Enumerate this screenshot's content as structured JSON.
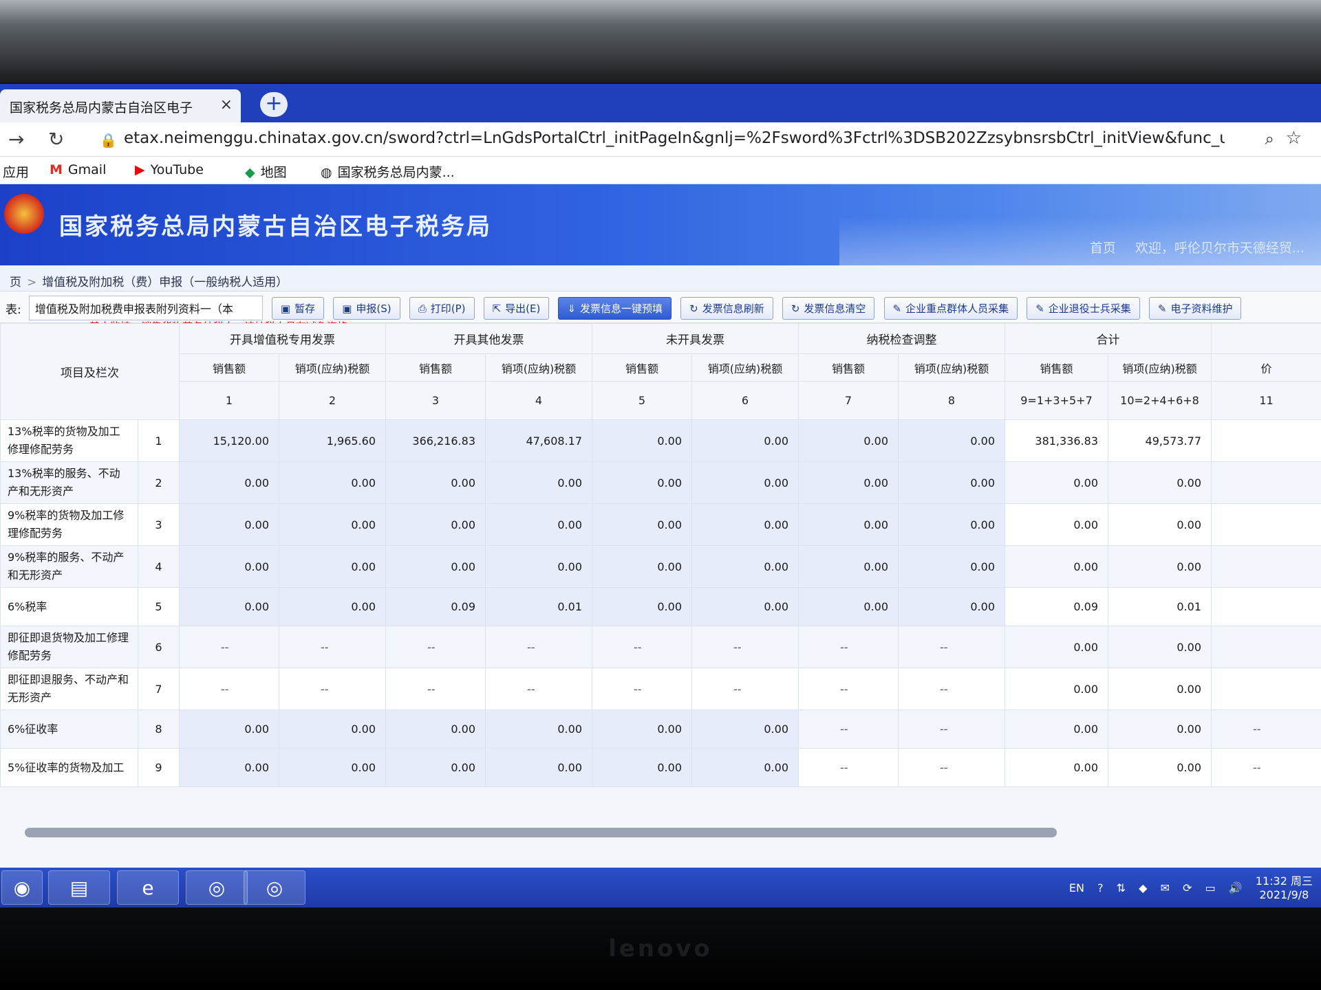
{
  "browser": {
    "tab_title": "国家税务总局内蒙古自治区电子",
    "tab_close": "×",
    "new_tab": "+",
    "url_host": "etax.neimenggu.chinatax.gov.cn",
    "url_path": "/sword?ctrl=LnGdsPortalCtrl_initPageIn&gnlj=%2Fsword%3Fctrl%3DSB202ZzsybnsrsbCtrl_initView&func_url=/sw...",
    "bookmarks": [
      "应用",
      "Gmail",
      "YouTube",
      "地图",
      "国家税务总局内蒙..."
    ]
  },
  "site": {
    "title": "国家税务总局内蒙古自治区电子税务局",
    "links": [
      "首页",
      "欢迎，呼伦贝尔市天德经贸..."
    ]
  },
  "breadcrumb": [
    "页",
    "增值税及附加税（费）申报（一般纳税人适用）"
  ],
  "toolbar": {
    "label": "表:",
    "select_value": "增值税及附加税费申报表附列资料一（本",
    "buttons": [
      "暂存",
      "申报(S)",
      "打印(P)",
      "导出(E)",
      "发票信息一键预填",
      "发票信息刷新",
      "发票信息清空",
      "企业重点群体人员采集",
      "企业退役士兵采集",
      "电子资料维护"
    ],
    "notice": "基本监控：销售货物劳务纳税人，该纳税人具有减免资格："
  },
  "table": {
    "row_header": "项目及栏次",
    "groups": [
      "开具增值税专用发票",
      "开具其他发票",
      "未开具发票",
      "纳税检查调整",
      "合计"
    ],
    "sub_headers": [
      "销售额",
      "销项(应纳)税额",
      "销售额",
      "销项(应纳)税额",
      "销售额",
      "销项(应纳)税额",
      "销售额",
      "销项(应纳)税额",
      "销售额",
      "销项(应纳)税额",
      "价"
    ],
    "col_index": [
      "1",
      "2",
      "3",
      "4",
      "5",
      "6",
      "7",
      "8",
      "9=1+3+5+7",
      "10=2+4+6+8",
      "11"
    ],
    "rows": [
      {
        "name": "13%税率的货物及加工修理修配劳务",
        "line": "1",
        "values": [
          "15,120.00",
          "1,965.60",
          "366,216.83",
          "47,608.17",
          "0.00",
          "0.00",
          "0.00",
          "0.00",
          "381,336.83",
          "49,573.77",
          ""
        ]
      },
      {
        "name": "13%税率的服务、不动产和无形资产",
        "line": "2",
        "values": [
          "0.00",
          "0.00",
          "0.00",
          "0.00",
          "0.00",
          "0.00",
          "0.00",
          "0.00",
          "0.00",
          "0.00",
          ""
        ]
      },
      {
        "name": "9%税率的货物及加工修理修配劳务",
        "line": "3",
        "values": [
          "0.00",
          "0.00",
          "0.00",
          "0.00",
          "0.00",
          "0.00",
          "0.00",
          "0.00",
          "0.00",
          "0.00",
          ""
        ]
      },
      {
        "name": "9%税率的服务、不动产和无形资产",
        "line": "4",
        "values": [
          "0.00",
          "0.00",
          "0.00",
          "0.00",
          "0.00",
          "0.00",
          "0.00",
          "0.00",
          "0.00",
          "0.00",
          ""
        ]
      },
      {
        "name": "6%税率",
        "line": "5",
        "values": [
          "0.00",
          "0.00",
          "0.09",
          "0.01",
          "0.00",
          "0.00",
          "0.00",
          "0.00",
          "0.09",
          "0.01",
          ""
        ]
      },
      {
        "name": "即征即退货物及加工修理修配劳务",
        "line": "6",
        "values": [
          "--",
          "--",
          "--",
          "--",
          "--",
          "--",
          "--",
          "--",
          "0.00",
          "0.00",
          ""
        ]
      },
      {
        "name": "即征即退服务、不动产和无形资产",
        "line": "7",
        "values": [
          "--",
          "--",
          "--",
          "--",
          "--",
          "--",
          "--",
          "--",
          "0.00",
          "0.00",
          ""
        ]
      },
      {
        "name": "6%征收率",
        "line": "8",
        "values": [
          "0.00",
          "0.00",
          "0.00",
          "0.00",
          "0.00",
          "0.00",
          "--",
          "--",
          "0.00",
          "0.00",
          "--"
        ]
      },
      {
        "name": "5%征收率的货物及加工",
        "line": "9",
        "values": [
          "0.00",
          "0.00",
          "0.00",
          "0.00",
          "0.00",
          "0.00",
          "--",
          "--",
          "0.00",
          "0.00",
          "--"
        ]
      }
    ]
  },
  "taskbar": {
    "lang": "EN",
    "time": "11:32 周三",
    "date": "2021/9/8"
  },
  "bezel": {
    "brand": "lenovo"
  },
  "colors": {
    "banner": "#2f62e0",
    "taskbar": "#1e3aa6",
    "notice": "#d21f1f"
  }
}
